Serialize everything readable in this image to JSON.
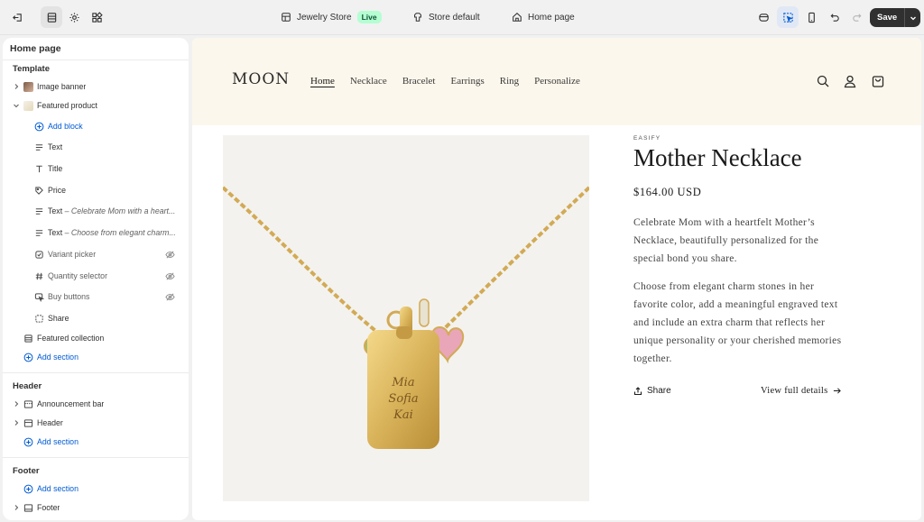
{
  "topbar": {
    "store_name": "Jewelry Store",
    "store_status": "Live",
    "theme_name": "Store default",
    "page_name": "Home page",
    "save_label": "Save"
  },
  "sidebar": {
    "title": "Home page",
    "template_heading": "Template",
    "template_items": {
      "image_banner": "Image banner",
      "featured_product": "Featured product",
      "add_block": "Add block",
      "blocks": [
        {
          "label": "Text",
          "sub": ""
        },
        {
          "label": "Title",
          "sub": ""
        },
        {
          "label": "Price",
          "sub": ""
        },
        {
          "label": "Text",
          "sub": " – Celebrate Mom with a heart..."
        },
        {
          "label": "Text",
          "sub": " – Choose from elegant charm..."
        },
        {
          "label": "Variant picker",
          "sub": ""
        },
        {
          "label": "Quantity selector",
          "sub": ""
        },
        {
          "label": "Buy buttons",
          "sub": ""
        },
        {
          "label": "Share",
          "sub": ""
        }
      ],
      "featured_collection": "Featured collection",
      "add_section": "Add section"
    },
    "header_heading": "Header",
    "header_items": {
      "announcement_bar": "Announcement bar",
      "header": "Header",
      "add_section": "Add section"
    },
    "footer_heading": "Footer",
    "footer_items": {
      "add_section": "Add section",
      "footer": "Footer"
    }
  },
  "preview": {
    "logo": "MOON",
    "nav": [
      "Home",
      "Necklace",
      "Bracelet",
      "Earrings",
      "Ring",
      "Personalize"
    ],
    "product": {
      "vendor": "EASIFY",
      "title": "Mother Necklace",
      "price": "$164.00 USD",
      "desc1": "Celebrate Mom with a heartfelt Mother’s Necklace, beautifully personalized for the special bond you share.",
      "desc2": "Choose from elegant charm stones in her favorite color, add a meaningful engraved text and include an extra charm that reflects her unique personality or your cherished memories together.",
      "share_label": "Share",
      "details_label": "View full details",
      "engraving": [
        "Mia",
        "Sofia",
        "Kai"
      ]
    }
  },
  "colors": {
    "accent_blue": "#005bd3",
    "header_bg": "#fcf7ec",
    "live_badge": "#b4fed2",
    "gold": "#d9b35a"
  }
}
